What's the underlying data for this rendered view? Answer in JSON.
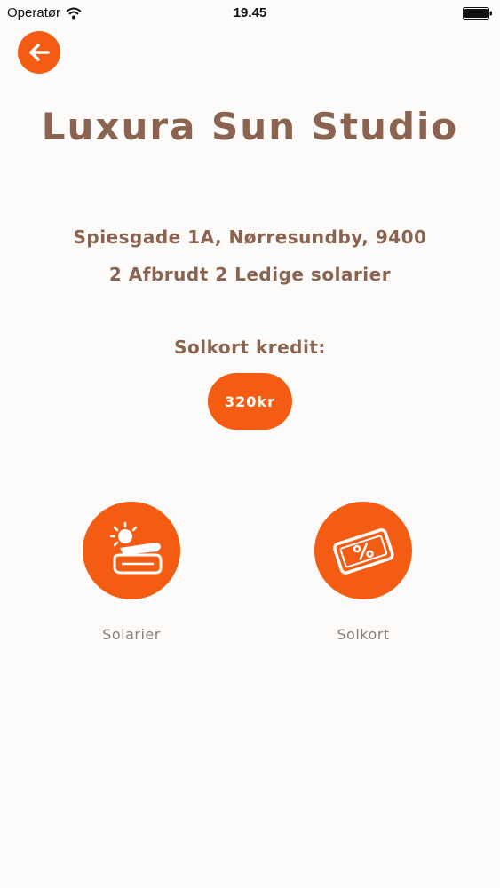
{
  "status_bar": {
    "carrier": "Operatør",
    "time": "19.45"
  },
  "colors": {
    "accent": "#f45c14",
    "text_brown": "#8a6450",
    "label_gray": "#8a7f78",
    "background": "#fdfbf9"
  },
  "header": {
    "back_icon": "arrow-left-icon",
    "title": "Luxura Sun Studio"
  },
  "info": {
    "address": "Spiesgade 1A, Nørresundby, 9400",
    "availability": "2 Afbrudt 2 Ledige solarier"
  },
  "credit": {
    "label": "Solkort kredit:",
    "amount": "320kr"
  },
  "tiles": [
    {
      "label": "Solarier",
      "icon": "sunbed-icon"
    },
    {
      "label": "Solkort",
      "icon": "discount-card-icon"
    }
  ]
}
